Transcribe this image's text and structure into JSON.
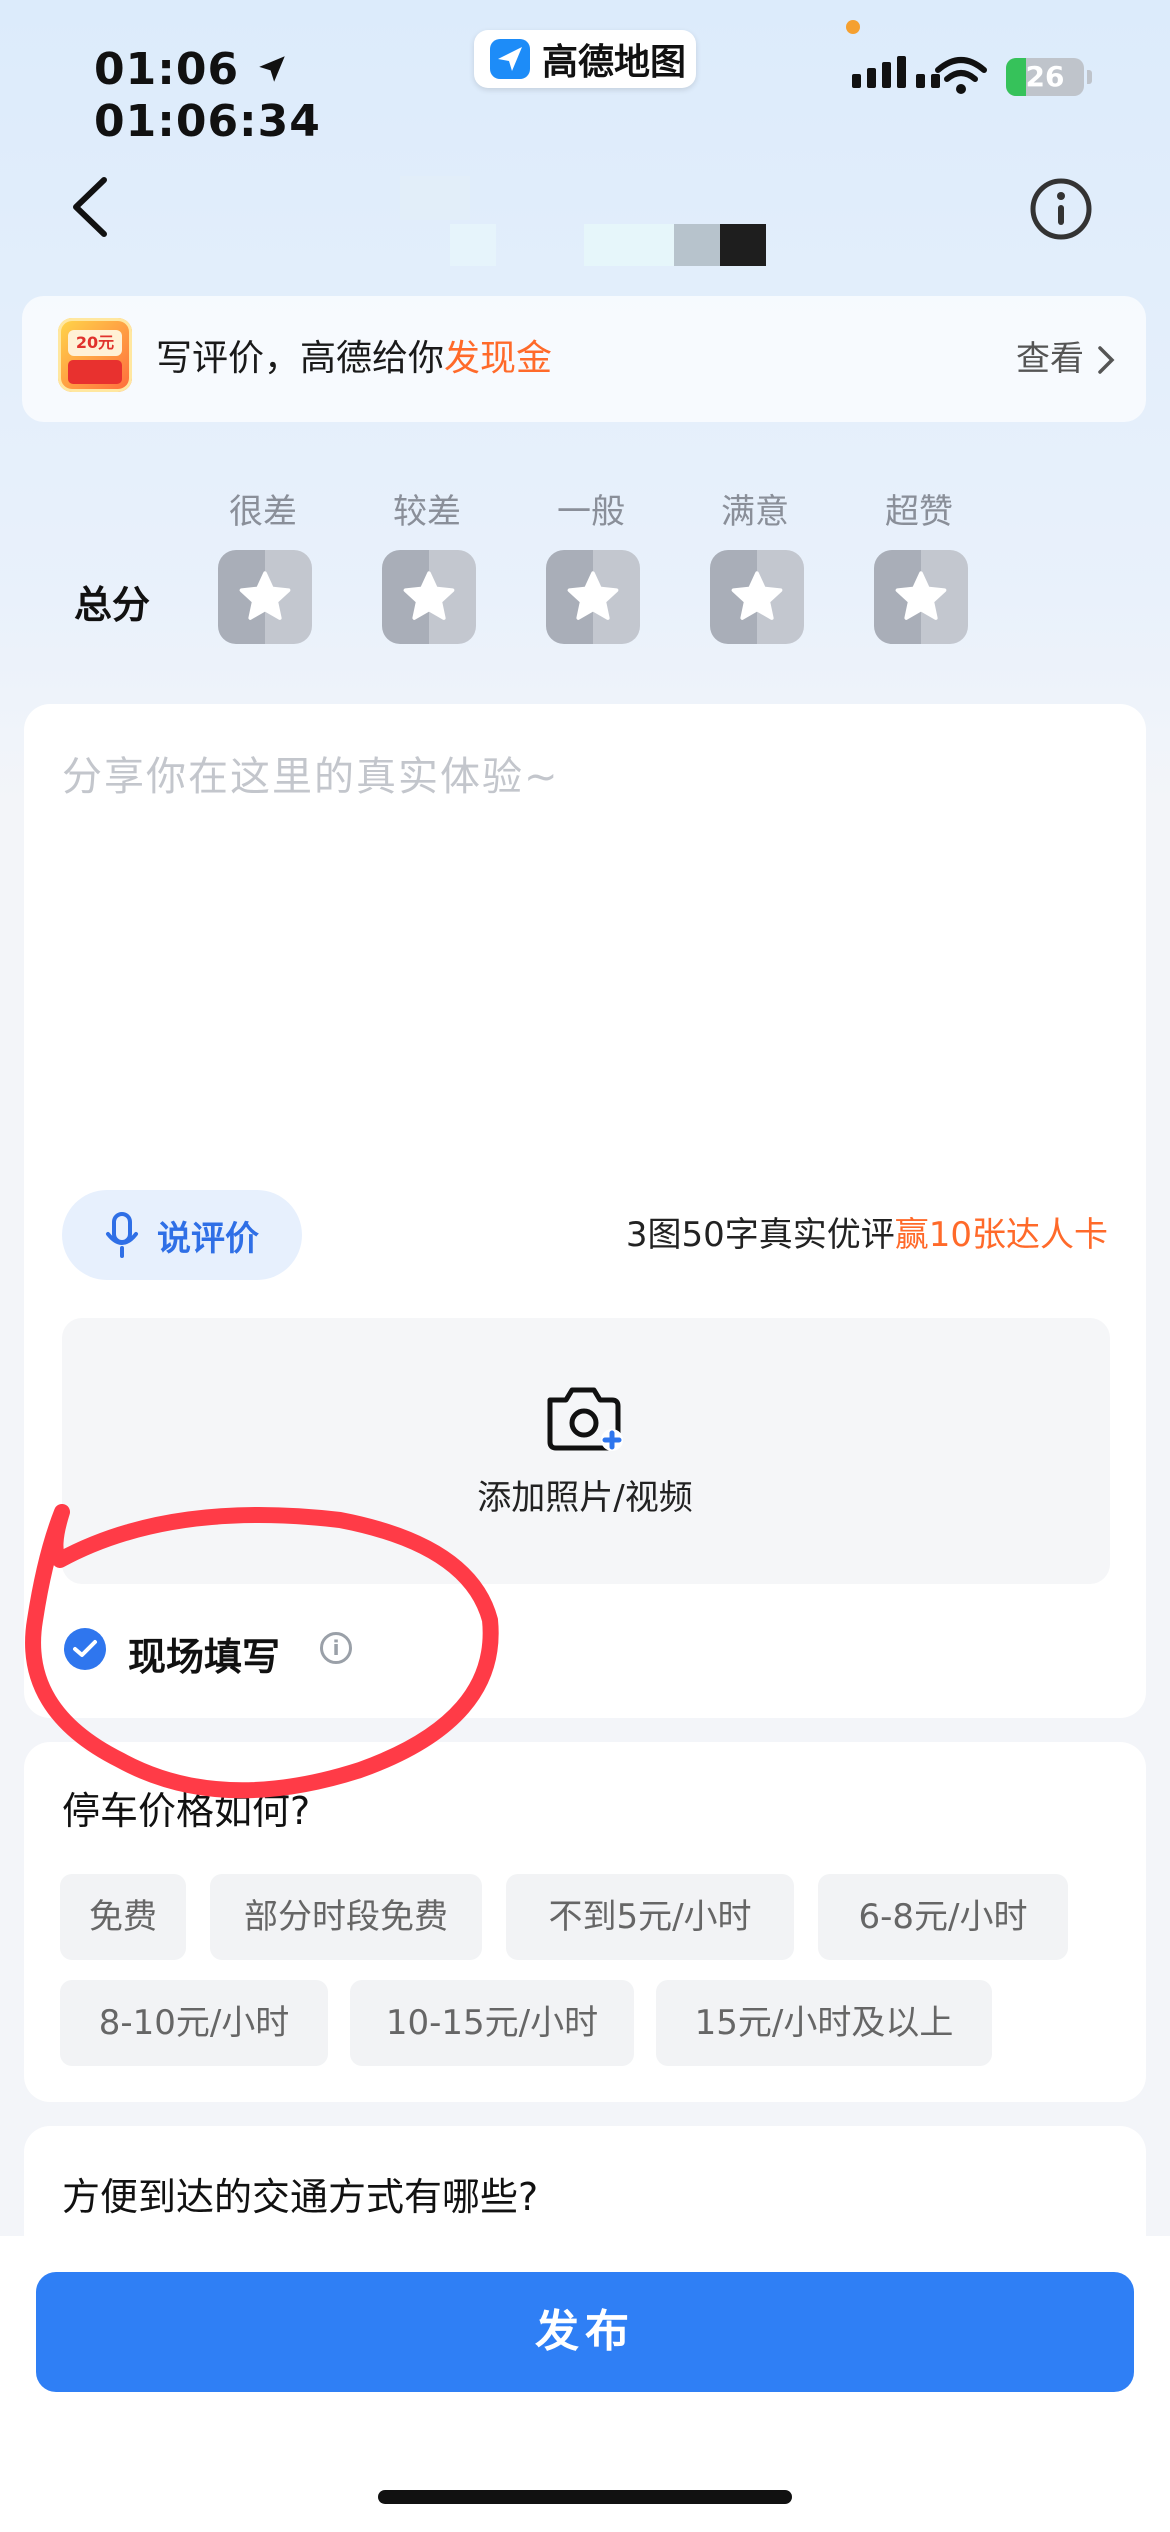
{
  "status_bar": {
    "time": "01:06",
    "time_seconds": "01:06:34",
    "app_name": "高德地图",
    "battery": "26"
  },
  "promo": {
    "text_prefix": "写评价，高德给你",
    "text_highlight": "发现金",
    "icon_tag": "20元",
    "link": "查看"
  },
  "rating": {
    "labels": [
      "很差",
      "较差",
      "一般",
      "满意",
      "超赞"
    ],
    "total_label": "总分"
  },
  "review": {
    "placeholder": "分享你在这里的真实体验~",
    "voice_button": "说评价",
    "tip_prefix": "3图50字真实优评",
    "tip_highlight": "赢10张达人卡",
    "upload_label": "添加照片/视频",
    "onsite_label": "现场填写",
    "onsite_checked": true
  },
  "parking": {
    "question": "停车价格如何?",
    "options": [
      "免费",
      "部分时段免费",
      "不到5元/小时",
      "6-8元/小时",
      "8-10元/小时",
      "10-15元/小时",
      "15元/小时及以上"
    ]
  },
  "transport": {
    "question": "方便到达的交通方式有哪些?"
  },
  "publish_button": "发布",
  "colors": {
    "accent": "#2f7ff5",
    "highlight": "#ff6a2a",
    "annotation": "#ff3b47"
  }
}
